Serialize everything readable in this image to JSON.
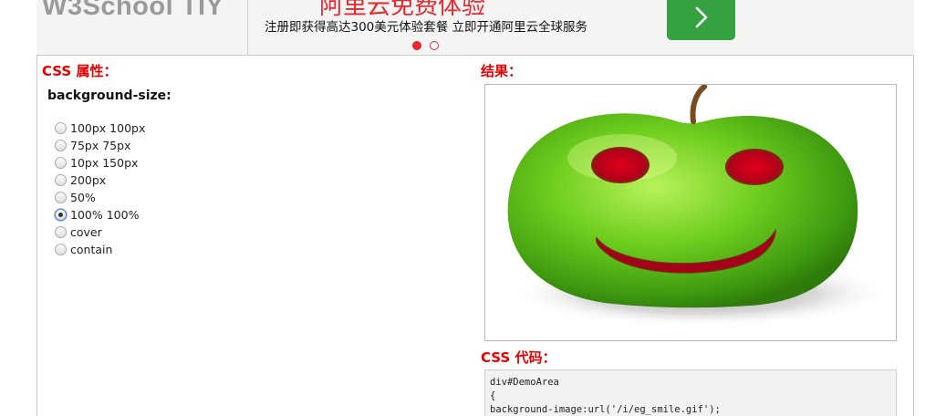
{
  "header": {
    "logo": "W3School TIY",
    "ad": {
      "title": "阿里云免费体验",
      "subtitle": "注册即获得高达300美元体验套餐 立即开通阿里云全球服务",
      "slide_count": 2,
      "active_slide": 1
    },
    "colors": {
      "ad_accent": "#e8262b",
      "ad_button": "#36a141"
    }
  },
  "css_props": {
    "section_label": "CSS 属性：",
    "property": "background-size:",
    "options": [
      {
        "label": "100px 100px",
        "checked": false
      },
      {
        "label": "75px 75px",
        "checked": false
      },
      {
        "label": "10px 150px",
        "checked": false
      },
      {
        "label": "200px",
        "checked": false
      },
      {
        "label": "50%",
        "checked": false
      },
      {
        "label": "100% 100%",
        "checked": true
      },
      {
        "label": "cover",
        "checked": false
      },
      {
        "label": "contain",
        "checked": false
      }
    ]
  },
  "result": {
    "section_label": "结果：",
    "image_subject": "smiling green apple"
  },
  "code": {
    "section_label": "CSS 代码：",
    "lines": [
      "div#DemoArea",
      "{",
      "background-image:url('/i/eg_smile.gif');"
    ]
  },
  "colors": {
    "label_red": "#e60000"
  }
}
